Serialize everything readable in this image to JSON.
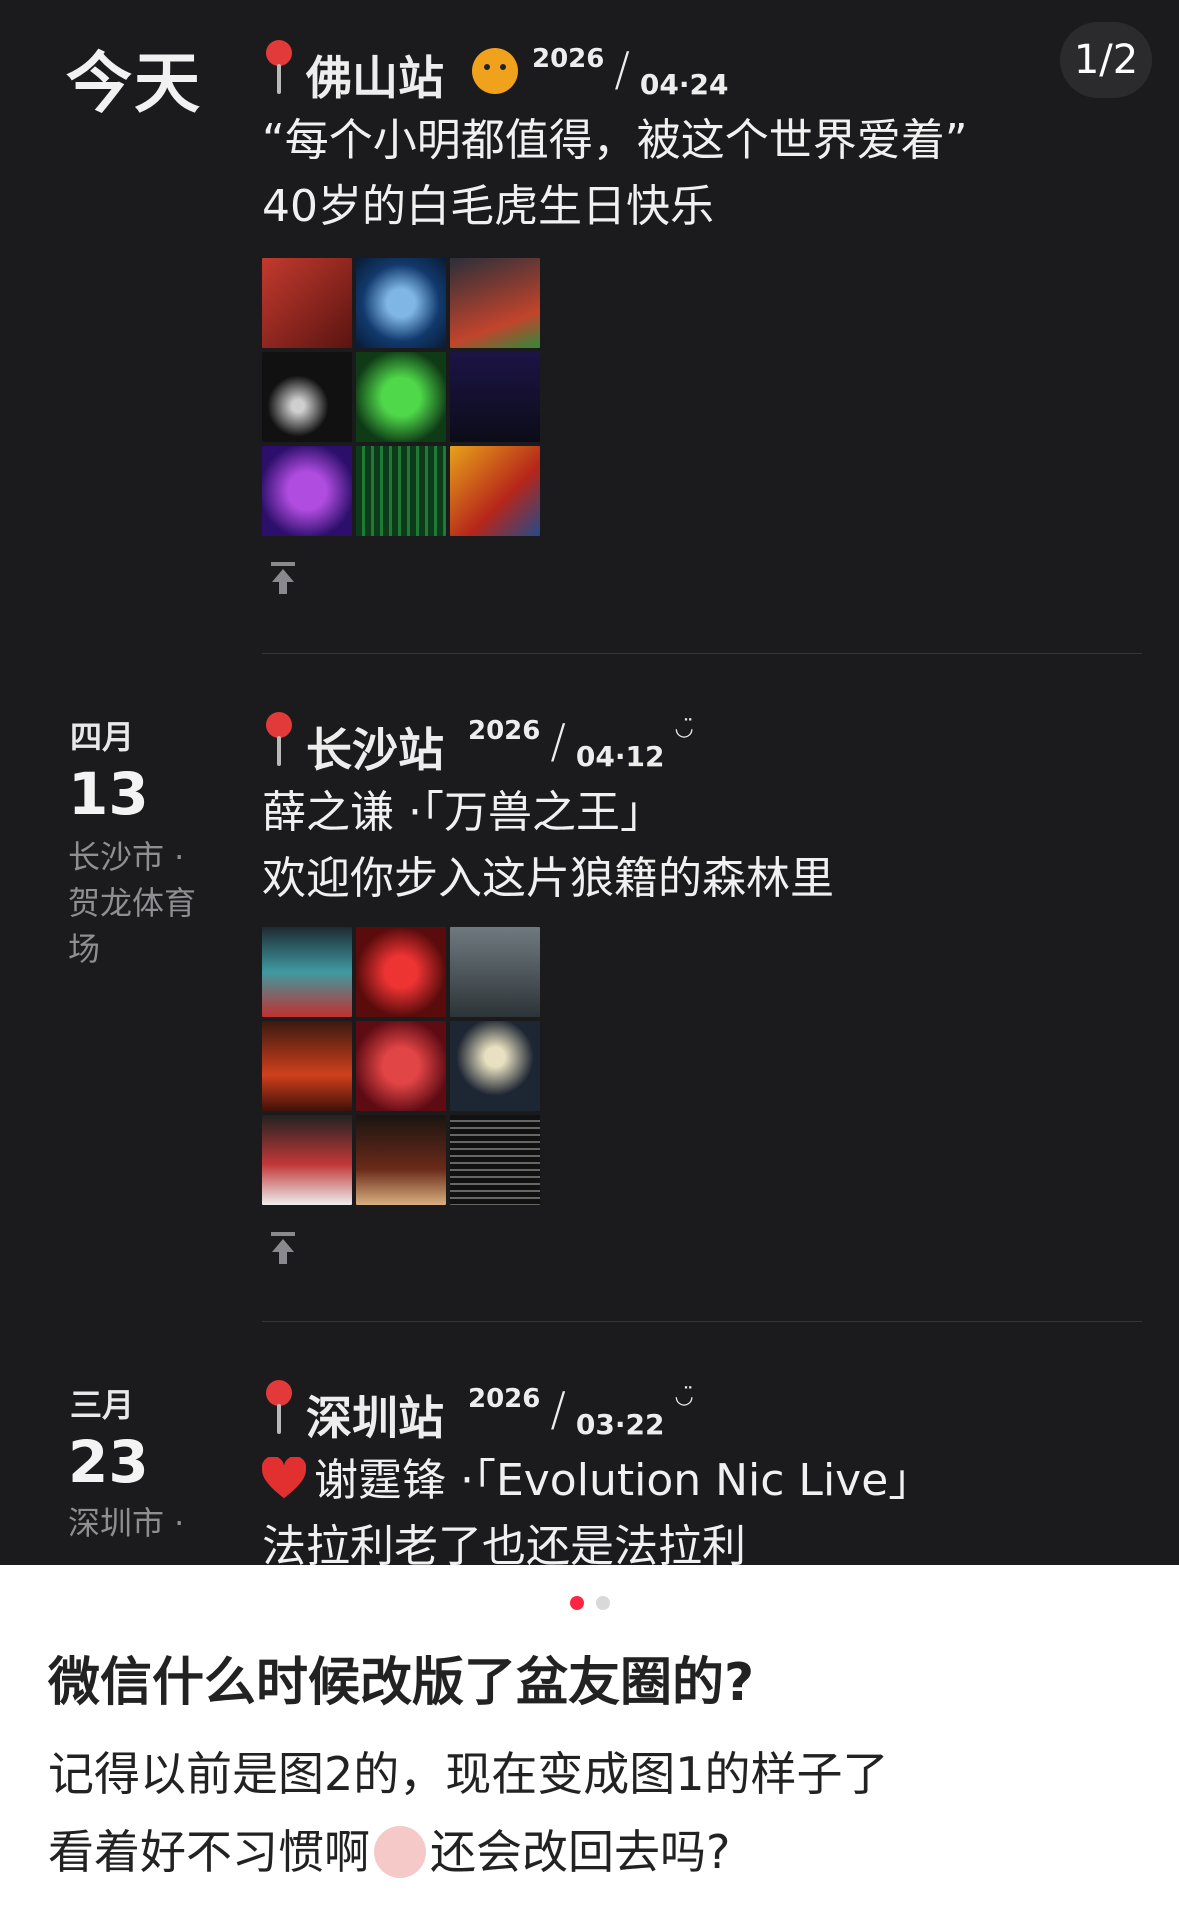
{
  "page_indicator": "1/2",
  "posts": [
    {
      "date_label": "今天",
      "station": "佛山站",
      "year": "2026",
      "month_day": "04·24",
      "line1": "“每个小明都值得，被这个世界爱着”",
      "line2": "40岁的白毛虎生日快乐"
    },
    {
      "month": "四月",
      "day": "13",
      "location": "长沙市 · 贺龙体育场",
      "station": "长沙站",
      "year": "2026",
      "month_day": "04·12",
      "line1": "薛之谦 ·「万兽之王」",
      "line2": "欢迎你步入这片狼籍的森林里"
    },
    {
      "month": "三月",
      "day": "23",
      "location": "深圳市 ·",
      "station": "深圳站",
      "year": "2026",
      "month_day": "03·22",
      "line1": "谢霆锋 ·「Evolution Nic Live」",
      "line2": "法拉利老了也还是法拉利"
    }
  ],
  "question": {
    "title": "微信什么时候改版了盆友圈的?",
    "line1": "记得以前是图2的，现在变成图1的样子了",
    "line2a": "看着好不习惯啊",
    "line2b": "还会改回去吗?"
  },
  "carousel": {
    "total": 2,
    "active": 1
  },
  "colors": {
    "dark_bg": "#1b1b1d",
    "accent": "#ff2442",
    "pin": "#e23a3a"
  }
}
